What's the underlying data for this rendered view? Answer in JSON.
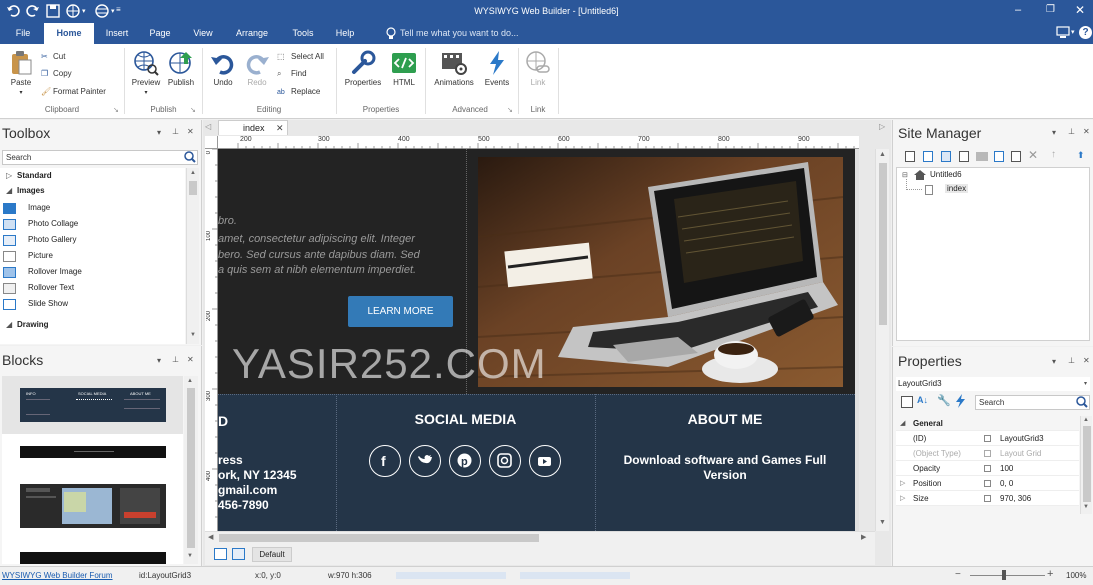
{
  "app": {
    "title": "WYSIWYG Web Builder - [Untitled6]",
    "tell_me": "Tell me what you want to do..."
  },
  "menu": [
    "File",
    "Home",
    "Insert",
    "Page",
    "View",
    "Arrange",
    "Tools",
    "Help"
  ],
  "ribbon": {
    "clipboard": {
      "paste": "Paste",
      "cut": "Cut",
      "copy": "Copy",
      "format_painter": "Format Painter",
      "group": "Clipboard"
    },
    "publish": {
      "preview": "Preview",
      "publish": "Publish",
      "group": "Publish"
    },
    "editing": {
      "undo": "Undo",
      "redo": "Redo",
      "select_all": "Select All",
      "find": "Find",
      "replace": "Replace",
      "group": "Editing"
    },
    "properties": {
      "properties": "Properties",
      "html": "HTML",
      "group": "Properties"
    },
    "advanced": {
      "animations": "Animations",
      "events": "Events",
      "group": "Advanced"
    },
    "link": {
      "link": "Link",
      "group": "Link"
    }
  },
  "toolbox": {
    "title": "Toolbox",
    "search_placeholder": "Search",
    "categories": {
      "standard": "Standard",
      "images": "Images",
      "drawing": "Drawing"
    },
    "image_items": [
      "Image",
      "Photo Collage",
      "Photo Gallery",
      "Picture",
      "Rollover Image",
      "Rollover Text",
      "Slide Show"
    ]
  },
  "blocks": {
    "title": "Blocks",
    "thumb1": {
      "col1": "INFO",
      "col2": "SOCIAL MEDIA",
      "col3": "ABOUT ME"
    }
  },
  "document": {
    "tab": "index",
    "bottom_tab": "Default",
    "ruler_labels": [
      "200",
      "300",
      "400",
      "500",
      "600",
      "700",
      "800",
      "900"
    ],
    "vruler_labels": [
      "0",
      "100",
      "200",
      "300",
      "400"
    ]
  },
  "canvas": {
    "hero": {
      "text_partial_1": "bro.",
      "text_partial_2": "amet, consectetur adipiscing elit. Integer",
      "text_partial_3": "bero. Sed cursus ante dapibus diam. Sed",
      "text_partial_4": "a quis sem at nibh elementum imperdiet.",
      "button": "LEARN MORE"
    },
    "watermark": "YASIR252.COM",
    "footer": {
      "col1_heading": "D",
      "address_1": "ress",
      "address_2": "ork, NY 12345",
      "email": "gmail.com",
      "phone": "456-7890",
      "social_heading": "SOCIAL MEDIA",
      "social_icons": [
        "facebook-icon",
        "twitter-icon",
        "pinterest-icon",
        "instagram-icon",
        "youtube-icon"
      ],
      "about_heading": "ABOUT ME",
      "about_text": "Download software and Games Full Version"
    }
  },
  "site_manager": {
    "title": "Site Manager",
    "tree_root": "Untitled6",
    "tree_child": "index"
  },
  "properties": {
    "title": "Properties",
    "selected": "LayoutGrid3",
    "search": "Search",
    "section": "General",
    "rows": [
      {
        "name": "(ID)",
        "value": "LayoutGrid3",
        "disabled": false
      },
      {
        "name": "(Object Type)",
        "value": "Layout Grid",
        "disabled": true
      },
      {
        "name": "Opacity",
        "value": "100",
        "disabled": false
      },
      {
        "name": "Position",
        "value": "0, 0",
        "disabled": false
      },
      {
        "name": "Size",
        "value": "970, 306",
        "disabled": false
      }
    ]
  },
  "status": {
    "forum": "WYSIWYG Web Builder Forum",
    "id": "id:LayoutGrid3",
    "xy": "x:0, y:0",
    "wh": "w:970 h:306",
    "zoom": "100%"
  },
  "colors": {
    "accent": "#2b579a",
    "canvas_dark": "#222222",
    "footer_navy": "#243548",
    "button_blue": "#337ab7"
  }
}
